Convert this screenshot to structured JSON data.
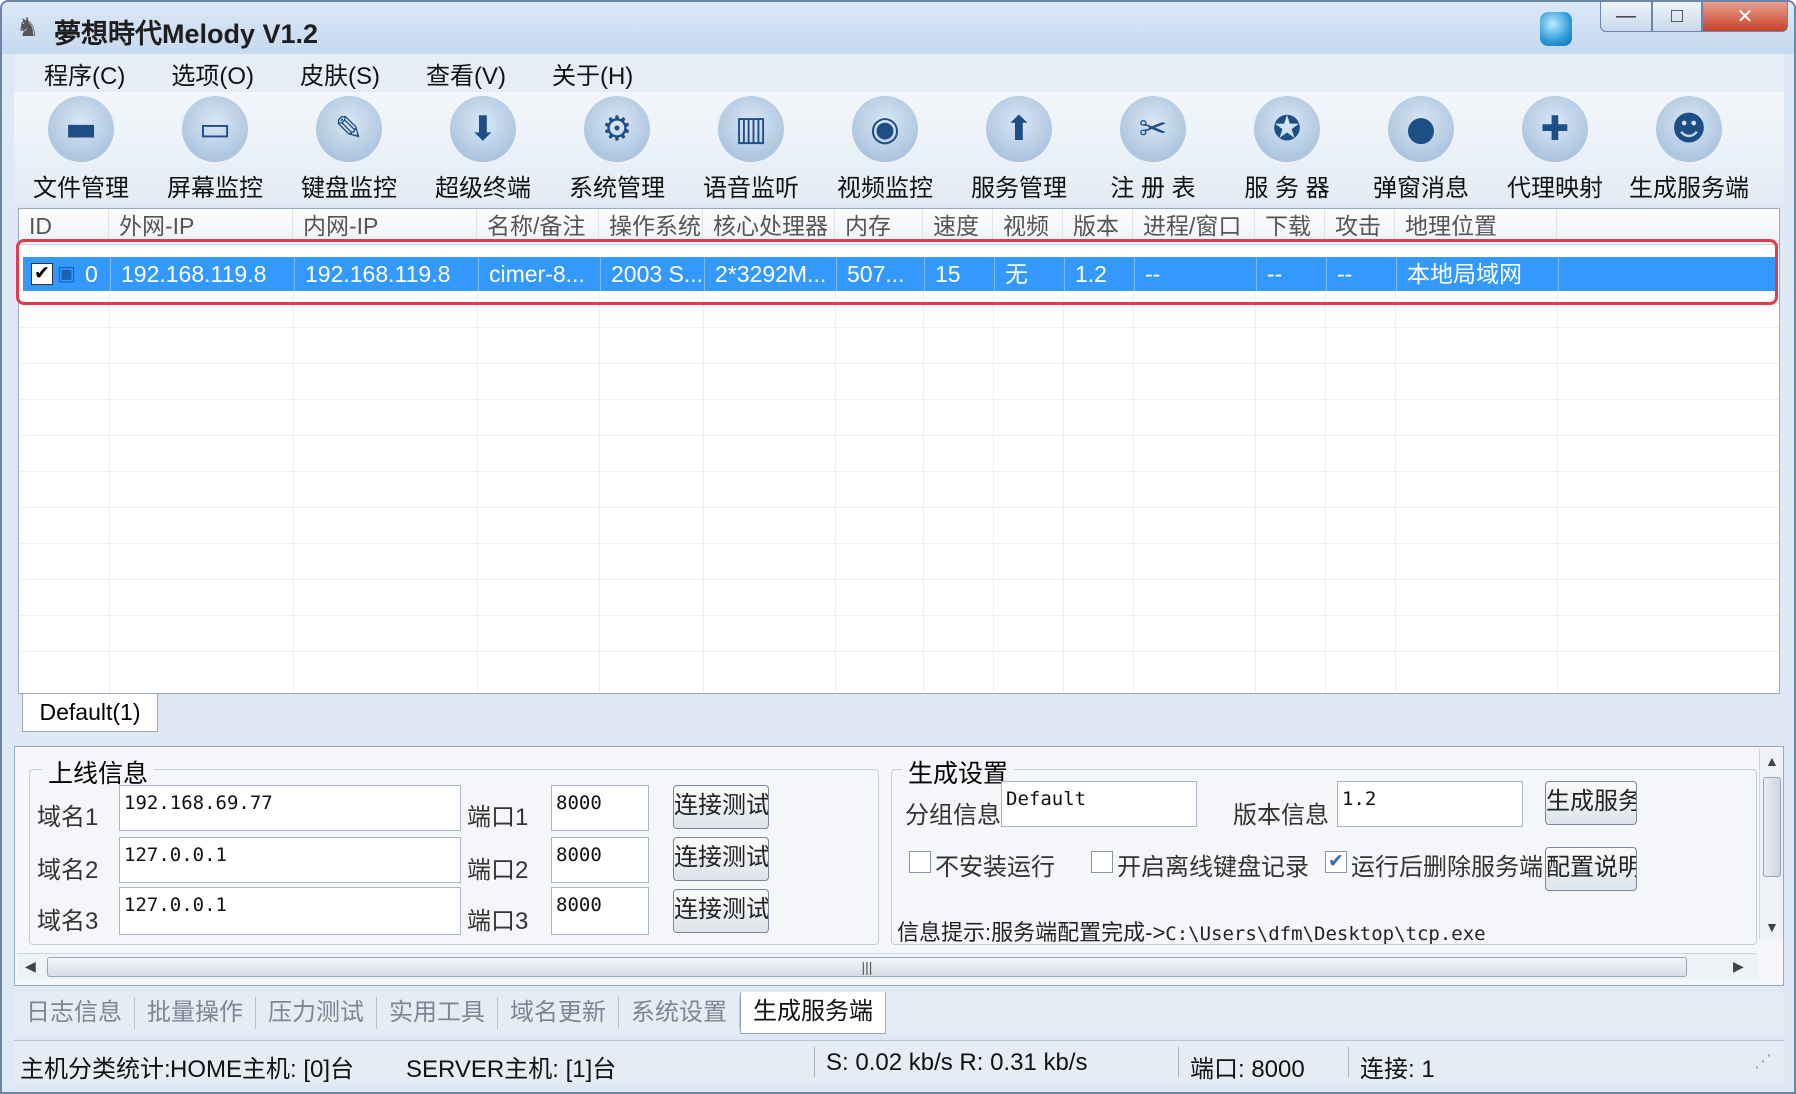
{
  "window": {
    "title": "夢想時代Melody V1.2",
    "app_icon": "goat-icon",
    "tray_icon": "shield-icon",
    "min": "—",
    "max": "□",
    "close": "✕"
  },
  "menu": [
    "程序(C)",
    "选项(O)",
    "皮肤(S)",
    "查看(V)",
    "关于(H)"
  ],
  "toolbar": [
    {
      "label": "文件管理",
      "icon": "folder-icon",
      "glyph": "▬"
    },
    {
      "label": "屏幕监控",
      "icon": "monitor-icon",
      "glyph": "▭"
    },
    {
      "label": "键盘监控",
      "icon": "pencil-icon",
      "glyph": "✎"
    },
    {
      "label": "超级终端",
      "icon": "download-icon",
      "glyph": "⬇"
    },
    {
      "label": "系统管理",
      "icon": "gear-icon",
      "glyph": "⚙"
    },
    {
      "label": "语音监听",
      "icon": "equalizer-icon",
      "glyph": "▥"
    },
    {
      "label": "视频监控",
      "icon": "camera-icon",
      "glyph": "◉"
    },
    {
      "label": "服务管理",
      "icon": "upload-icon",
      "glyph": "⬆"
    },
    {
      "label": "注 册 表",
      "icon": "tools-icon",
      "glyph": "✂"
    },
    {
      "label": "服 务 器",
      "icon": "award-icon",
      "glyph": "✪"
    },
    {
      "label": "弹窗消息",
      "icon": "chat-bubble-icon",
      "glyph": "●"
    },
    {
      "label": "代理映射",
      "icon": "wrench-icon",
      "glyph": "✚"
    },
    {
      "label": "生成服务端",
      "icon": "users-icon",
      "glyph": "☻"
    }
  ],
  "grid": {
    "columns": [
      "ID",
      "外网-IP",
      "内网-IP",
      "名称/备注",
      "操作系统",
      "核心处理器",
      "内存",
      "速度",
      "视频",
      "版本",
      "进程/窗口",
      "下载",
      "攻击",
      "地理位置"
    ],
    "rows": [
      {
        "checked": "✔",
        "icon": "computer-icon",
        "cells": [
          "0",
          "192.168.119.8",
          "192.168.119.8",
          "cimer-8...",
          "2003 S...",
          "2*3292M...",
          "507...",
          "15",
          "无",
          "1.2",
          "--",
          "--",
          "--",
          "本地局域网"
        ]
      }
    ]
  },
  "group_tab": "Default(1)",
  "online": {
    "legend": "上线信息",
    "rows": [
      {
        "domain_label": "域名1",
        "domain": "192.168.69.77",
        "port_label": "端口1",
        "port": "8000",
        "button": "连接测试"
      },
      {
        "domain_label": "域名2",
        "domain": "127.0.0.1",
        "port_label": "端口2",
        "port": "8000",
        "button": "连接测试"
      },
      {
        "domain_label": "域名3",
        "domain": "127.0.0.1",
        "port_label": "端口3",
        "port": "8000",
        "button": "连接测试"
      }
    ]
  },
  "build": {
    "legend": "生成设置",
    "group_label": "分组信息",
    "group_value": "Default",
    "version_label": "版本信息",
    "version_value": "1.2",
    "build_button": "生成服务端",
    "config_button": "配置说明",
    "options": [
      {
        "label": "不安装运行",
        "checked": ""
      },
      {
        "label": "开启离线键盘记录",
        "checked": ""
      },
      {
        "label": "运行后删除服务端",
        "checked": "✔"
      }
    ],
    "hint_label": "信息提示:服务端配置完成->",
    "hint_path": "C:\\Users\\dfm\\Desktop\\tcp.exe"
  },
  "tabs": [
    "日志信息",
    "批量操作",
    "压力测试",
    "实用工具",
    "域名更新",
    "系统设置",
    "生成服务端"
  ],
  "active_tab": 6,
  "status": {
    "stats": "主机分类统计:",
    "home": "HOME主机: [0]台",
    "server": "SERVER主机: [1]台",
    "speed": "S: 0.02 kb/s R: 0.31 kb/s",
    "port": "端口: 8000",
    "conn": "连接: 1"
  },
  "colors": {
    "selection": "#3399ff",
    "highlight_outline": "#e23b4a"
  }
}
